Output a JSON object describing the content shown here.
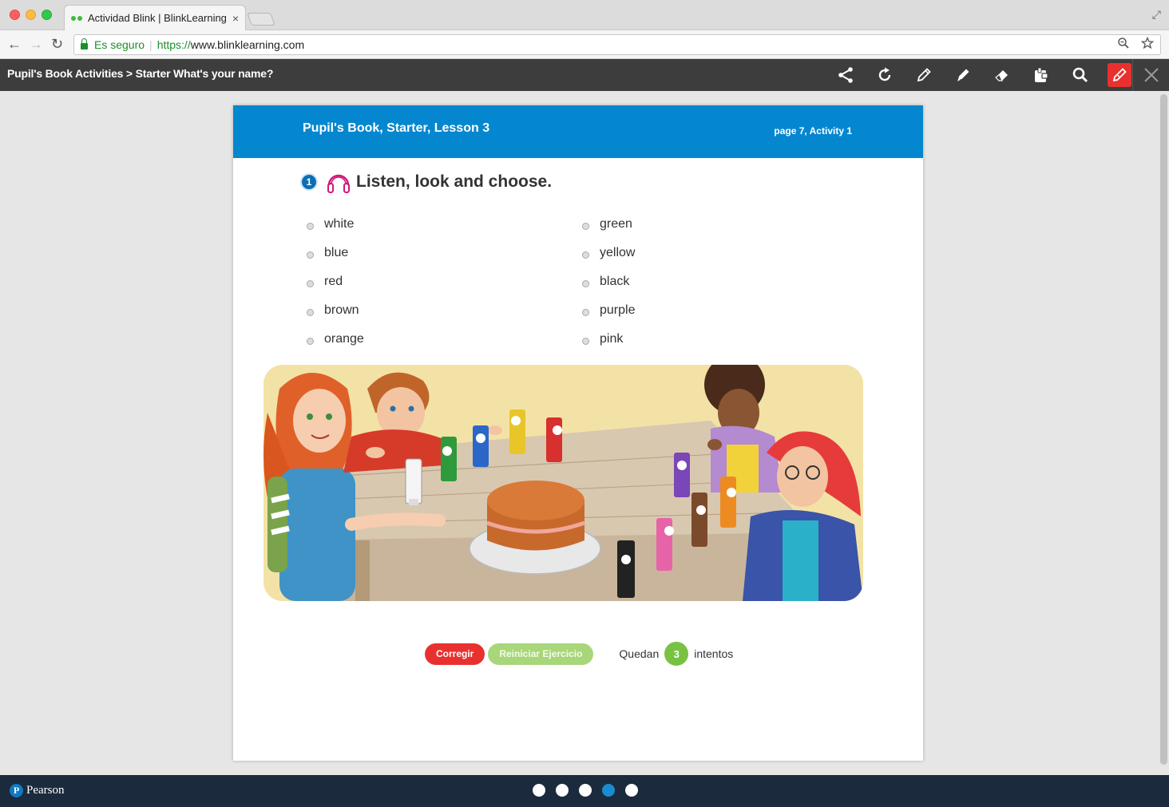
{
  "browser": {
    "tab_title": "Actividad Blink | BlinkLearning",
    "tab_close": "×",
    "security_label": "Es seguro",
    "url_scheme": "https://",
    "url_host": "www.blinklearning.com"
  },
  "app": {
    "breadcrumb": "Pupil's Book Activities > Starter What's your name?",
    "tools": [
      "share-icon",
      "refresh-icon",
      "pencil-icon",
      "marker-icon",
      "eraser-icon",
      "sticky-note-icon",
      "search-icon",
      "draw-mode-icon"
    ],
    "accent_color": "#e8312f"
  },
  "page": {
    "lesson_title": "Pupil's Book, Starter, Lesson 3",
    "page_ref": "page 7, Activity 1",
    "activity_number": "1",
    "instruction": "Listen, look and choose.",
    "options_left": [
      "white",
      "blue",
      "red",
      "brown",
      "orange"
    ],
    "options_right": [
      "green",
      "yellow",
      "black",
      "purple",
      "pink"
    ],
    "header_color": "#0587d0"
  },
  "actions": {
    "check_label": "Corregir",
    "reset_label": "Reiniciar Ejercicio",
    "attempts_prefix": "Quedan",
    "attempts_count": "3",
    "attempts_suffix": "intentos"
  },
  "footer": {
    "brand": "Pearson",
    "pages_total": 5,
    "current_page": 4
  }
}
